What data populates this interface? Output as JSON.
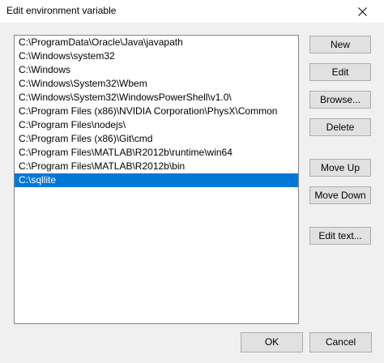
{
  "window": {
    "title": "Edit environment variable"
  },
  "path_list": {
    "items": [
      "C:\\ProgramData\\Oracle\\Java\\javapath",
      "C:\\Windows\\system32",
      "C:\\Windows",
      "C:\\Windows\\System32\\Wbem",
      "C:\\Windows\\System32\\WindowsPowerShell\\v1.0\\",
      "C:\\Program Files (x86)\\NVIDIA Corporation\\PhysX\\Common",
      "C:\\Program Files\\nodejs\\",
      "C:\\Program Files (x86)\\Git\\cmd",
      "C:\\Program Files\\MATLAB\\R2012b\\runtime\\win64",
      "C:\\Program Files\\MATLAB\\R2012b\\bin",
      "C:\\sqllite"
    ],
    "selected_index": 10
  },
  "buttons": {
    "new": "New",
    "edit": "Edit",
    "browse": "Browse...",
    "delete": "Delete",
    "move_up": "Move Up",
    "move_down": "Move Down",
    "edit_text": "Edit text...",
    "ok": "OK",
    "cancel": "Cancel"
  },
  "colors": {
    "selection": "#0078d7",
    "button_face": "#e1e1e1",
    "dialog_background": "#f0f0f0"
  },
  "icons": {
    "close": "close-icon"
  }
}
